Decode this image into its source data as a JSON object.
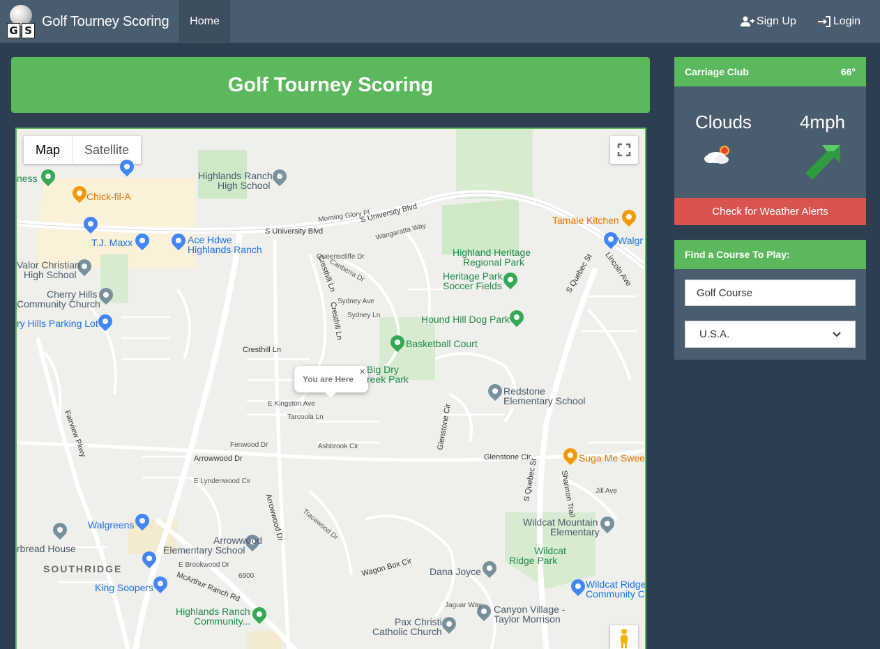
{
  "navbar": {
    "brand": "Golf Tourney Scoring",
    "logo_letters": [
      "G",
      "S"
    ],
    "home": "Home",
    "signup": "Sign Up",
    "login": "Login",
    "icons": [
      "user-plus-icon",
      "sign-in-icon"
    ]
  },
  "banner": {
    "title": "Golf Tourney Scoring"
  },
  "map": {
    "map_btn": "Map",
    "satellite_btn": "Satellite",
    "infowindow": "You are Here",
    "close": "×",
    "places": {
      "chick": "Chick-fil-A",
      "hrhs1": "Highlands Ranch",
      "hrhs2": "High School",
      "tjmaxx": "T.J. Maxx",
      "ace1": "Ace Hdwe",
      "ace2": "Highlands Ranch",
      "valor1": "Valor Christian",
      "valor2": "High School",
      "cherry1": "Cherry Hills",
      "cherry2": "Community Church",
      "parking": "ry Hills Parking Lot",
      "heritage1": "Highland Heritage",
      "heritage2": "Regional Park",
      "soccer1": "Heritage Park",
      "soccer2": "Soccer Fields",
      "dog": "Hound Hill Dog Park",
      "basketball": "Basketball Court",
      "bigdry1": "Big Dry",
      "bigdry2": "reek Park",
      "redstone1": "Redstone",
      "redstone2": "Elementary School",
      "tamale": "Tamale Kitchen",
      "walg": "Walgr",
      "suga": "Suga Me Sweet",
      "wildcatmtn1": "Wildcat Mountain",
      "wildcatmtn2": "Elementary",
      "wildcatpark1": "Wildcat",
      "wildcatpark2": "Ridge Park",
      "wildcatcc1": "Wildcat Ridge",
      "wildcatcc2": "Community Ch",
      "walgreens": "Walgreens",
      "arrowood1": "Arrowwood",
      "arrowood2": "Elementary School",
      "breadhouse": "rbread House",
      "southridge": "SOUTHRIDGE",
      "kingsoopers": "King Soopers",
      "hrcomm1": "Highlands Ranch",
      "hrcomm2": "Community...",
      "danajoyce": "Dana Joyce",
      "canyon1": "Canyon Village -",
      "canyon2": "Taylor Morrison",
      "paxchristi1": "Pax Christi",
      "paxchristi2": "Catholic Church",
      "ness": "ness"
    },
    "roads": {
      "univ1": "S University Blvd",
      "univ2": "S University Blvd",
      "cresthillln": "Cresthill Ln",
      "cresthill2": "Cresthill Ln",
      "cresthill3": "Cresthill Ln",
      "fairview": "Fairview Pkwy",
      "arrowwooddr": "Arrowwood Dr",
      "arrowwooddr2": "Arrowwood Dr",
      "glenstonecir": "Glenstone Cir",
      "glenstonecir2": "Glenstone Cir",
      "quebec": "S Quebec St",
      "quebec2": "S Quebec St",
      "shannon": "Shannon Trail",
      "mcarthur": "McArthur Ranch Rd",
      "lincoln": "Lincoln Ave",
      "wagonbox": "Wagon Box Cir",
      "morningglory": "Morning Glory Pl",
      "kingston": "E Kingston Ave",
      "tarcoola": "Tarcoola Ln",
      "ashbrook": "Ashbrook Cir",
      "fenwood": "Fenwood Dr",
      "lyndenwood": "E Lyndenwood Cir",
      "sydney": "Sydney Ave",
      "sydneyln": "Sydney Ln",
      "jillave": "Jill Ave",
      "brookwood": "E Brookwood Dr",
      "tracewood": "Tracewood Dr",
      "jaguar": "Jaguar Way",
      "wangaratta": "Wangaratta Way",
      "canberra": "Canberra Dr",
      "queenscliffe": "Queenscliffe Dr",
      "heritagesign": "6900"
    }
  },
  "weather": {
    "location": "Carriage Club",
    "temp": "66°",
    "condition": "Clouds",
    "wind": "4mph",
    "alert_button": "Check for Weather Alerts",
    "icons": [
      "cloud-sun-icon",
      "wind-arrow-icon"
    ]
  },
  "find_course": {
    "title": "Find a Course To Play:",
    "input_value": "Golf Course",
    "country": "U.S.A."
  }
}
